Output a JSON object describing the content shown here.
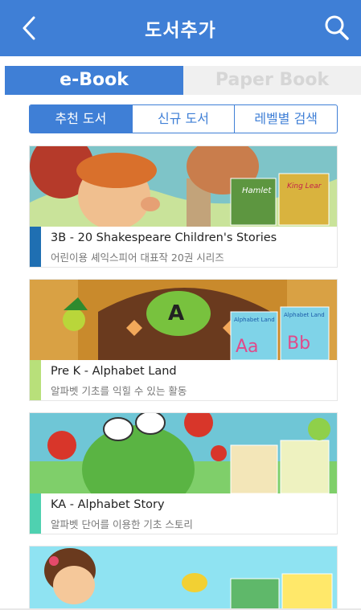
{
  "header": {
    "title": "도서추가",
    "back_icon": "chevron-left-icon",
    "search_icon": "search-icon"
  },
  "media_tabs": [
    {
      "label": "e-Book",
      "active": true
    },
    {
      "label": "Paper Book",
      "active": false
    }
  ],
  "category_tabs": [
    {
      "label": "추천 도서",
      "active": true
    },
    {
      "label": "신규 도서",
      "active": false
    },
    {
      "label": "레벨별 검색",
      "active": false
    }
  ],
  "colors": {
    "brand": "#3f7fd6"
  },
  "books": [
    {
      "title": "3B - 20 Shakespeare Children's Stories",
      "subtitle": "어린이용 셰익스피어 대표작 20권 시리즈",
      "accent": "#1f6fb2",
      "cover_texts": [
        "Hamlet",
        "King Lear"
      ]
    },
    {
      "title": "Pre K - Alphabet Land",
      "subtitle": "알파벳 기초를 익힐 수 있는 활동",
      "accent": "#b8e07a",
      "cover_texts": [
        "A",
        "Alphabet Land",
        "Aa",
        "Alphabet Land",
        "Bb"
      ]
    },
    {
      "title": "KA - Alphabet Story",
      "subtitle": "알파벳 단어를 이용한 기초 스토리",
      "accent": "#4fd1b0",
      "cover_texts": []
    },
    {
      "title": "",
      "subtitle": "",
      "accent": "#ffffff",
      "cover_texts": []
    }
  ]
}
